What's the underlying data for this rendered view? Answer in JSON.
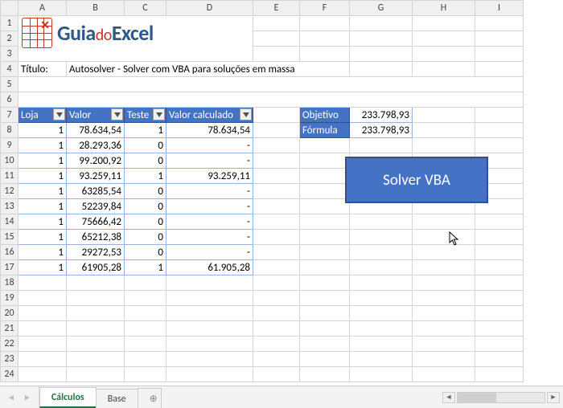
{
  "logo": {
    "brand1": "Guia",
    "brand2": "do",
    "brand3": "Excel"
  },
  "titleLabel": "Título:",
  "titleValue": "Autosolver - Solver com VBA para soluções em massa",
  "columns": [
    "A",
    "B",
    "C",
    "D",
    "E",
    "F",
    "G",
    "H",
    "I"
  ],
  "rowNumbers": [
    "1",
    "2",
    "3",
    "4",
    "5",
    "6",
    "7",
    "8",
    "9",
    "10",
    "11",
    "12",
    "13",
    "14",
    "15",
    "16",
    "17",
    "18",
    "19",
    "20",
    "21",
    "22",
    "23",
    "24"
  ],
  "headers": {
    "loja": "Loja",
    "valor": "Valor",
    "teste": "Teste",
    "valorCalc": "Valor calculado"
  },
  "rows": [
    {
      "loja": "1",
      "valor": "78.634,54",
      "teste": "1",
      "calc": "78.634,54"
    },
    {
      "loja": "1",
      "valor": "28.293,36",
      "teste": "0",
      "calc": "-"
    },
    {
      "loja": "1",
      "valor": "99.200,92",
      "teste": "0",
      "calc": "-"
    },
    {
      "loja": "1",
      "valor": "93.259,11",
      "teste": "1",
      "calc": "93.259,11"
    },
    {
      "loja": "1",
      "valor": "63285,54",
      "teste": "0",
      "calc": "-"
    },
    {
      "loja": "1",
      "valor": "52239,84",
      "teste": "0",
      "calc": "-"
    },
    {
      "loja": "1",
      "valor": "75666,42",
      "teste": "0",
      "calc": "-"
    },
    {
      "loja": "1",
      "valor": "65212,38",
      "teste": "0",
      "calc": "-"
    },
    {
      "loja": "1",
      "valor": "29272,53",
      "teste": "0",
      "calc": "-"
    },
    {
      "loja": "1",
      "valor": "61905,28",
      "teste": "1",
      "calc": "61.905,28"
    }
  ],
  "side": {
    "objetivoLabel": "Objetivo",
    "objetivoVal": "233.798,93",
    "formulaLabel": "Fórmula",
    "formulaVal": "233.798,93"
  },
  "solverButton": "Solver VBA",
  "tabs": {
    "calculos": "Cálculos",
    "base": "Base",
    "add": "⊕"
  }
}
